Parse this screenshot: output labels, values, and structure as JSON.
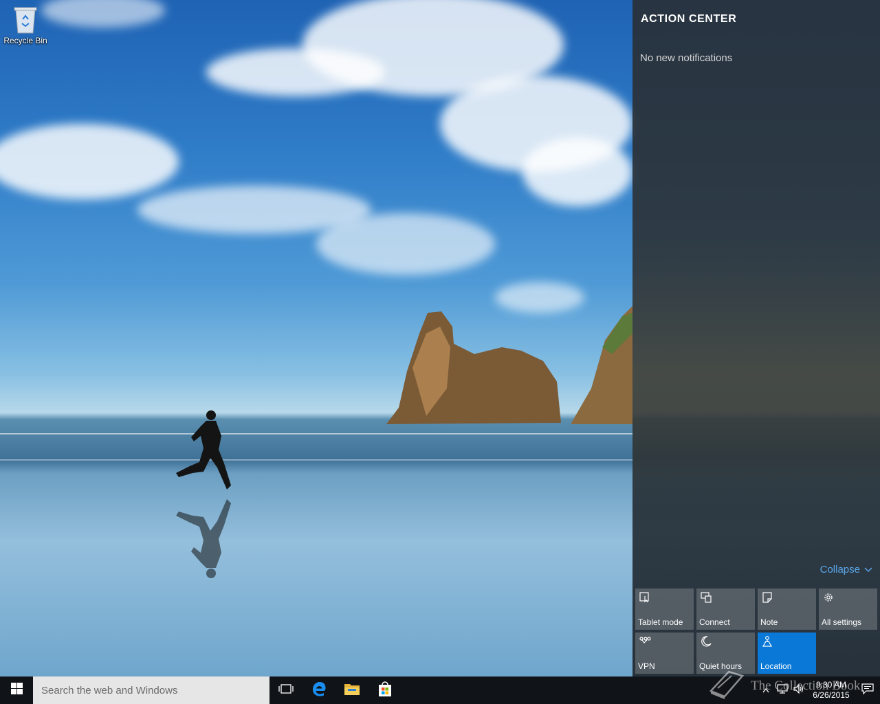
{
  "desktop": {
    "icons": [
      {
        "label": "Recycle Bin",
        "icon": "recycle-bin-icon"
      }
    ]
  },
  "action_center": {
    "title": "ACTION CENTER",
    "empty_message": "No new notifications",
    "collapse_label": "Collapse",
    "accent_color": "#0a78d7",
    "tiles": [
      {
        "label": "Tablet mode",
        "icon": "tablet-mode-icon",
        "active": false
      },
      {
        "label": "Connect",
        "icon": "connect-icon",
        "active": false
      },
      {
        "label": "Note",
        "icon": "note-icon",
        "active": false
      },
      {
        "label": "All settings",
        "icon": "gear-icon",
        "active": false
      },
      {
        "label": "VPN",
        "icon": "vpn-icon",
        "active": false
      },
      {
        "label": "Quiet hours",
        "icon": "moon-icon",
        "active": false
      },
      {
        "label": "Location",
        "icon": "location-icon",
        "active": true
      }
    ]
  },
  "taskbar": {
    "search_placeholder": "Search the web and Windows",
    "pinned": [
      {
        "name": "task-view",
        "icon": "task-view-icon"
      },
      {
        "name": "edge",
        "icon": "edge-icon"
      },
      {
        "name": "file-explorer",
        "icon": "folder-icon"
      },
      {
        "name": "store",
        "icon": "store-icon"
      }
    ],
    "clock": {
      "time": "9:30 AM",
      "date": "6/26/2015"
    }
  },
  "watermark": {
    "text": "The Collection Book"
  }
}
